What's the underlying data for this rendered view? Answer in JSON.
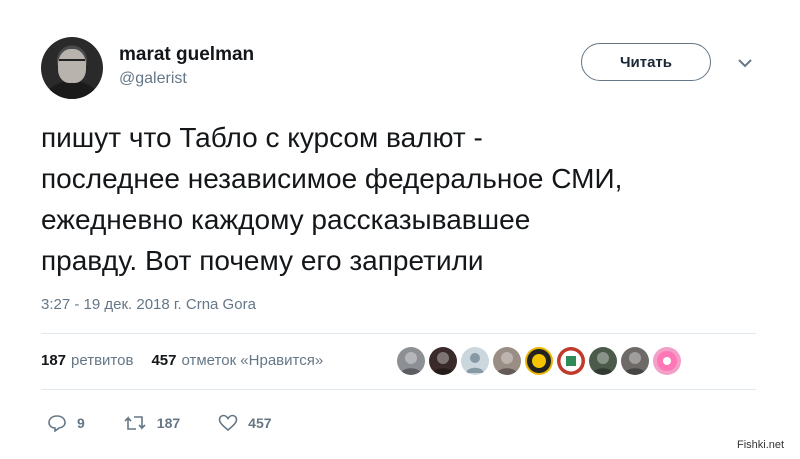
{
  "author": {
    "name": "marat guelman",
    "handle": "@galerist"
  },
  "follow_button": {
    "label": "Читать"
  },
  "tweet": {
    "text": "пишут что Табло с курсом валют -\nпоследнее независимое федеральное СМИ,\nежедневно каждому рассказывавшее\nправду. Вот почему его запретили",
    "meta": "3:27 - 19 дек. 2018 г. Crna Gora"
  },
  "stats": {
    "retweets_count": "187",
    "retweets_label": "ретвитов",
    "likes_count": "457",
    "likes_label": "отметок «Нравится»"
  },
  "likers": [
    {
      "icon": "avatar-photo",
      "color": "#8c8f94"
    },
    {
      "icon": "avatar-dark",
      "color": "#3a2a2a"
    },
    {
      "icon": "avatar-default",
      "color": "#ccd6dd"
    },
    {
      "icon": "avatar-photo",
      "color": "#9a8d85"
    },
    {
      "icon": "avatar-yellow-logo",
      "color": "#e8b400"
    },
    {
      "icon": "avatar-red-logo",
      "color": "#c0392b"
    },
    {
      "icon": "avatar-green-dark",
      "color": "#4b5a4a"
    },
    {
      "icon": "avatar-photo",
      "color": "#6d6a68"
    },
    {
      "icon": "avatar-pink",
      "color": "#f2a0c8"
    }
  ],
  "actions": {
    "reply_count": "9",
    "retweet_count": "187",
    "like_count": "457"
  },
  "watermark": "Fishki.net",
  "colors": {
    "text": "#14171a",
    "secondary": "#657786",
    "divider": "#e1e8ed"
  }
}
